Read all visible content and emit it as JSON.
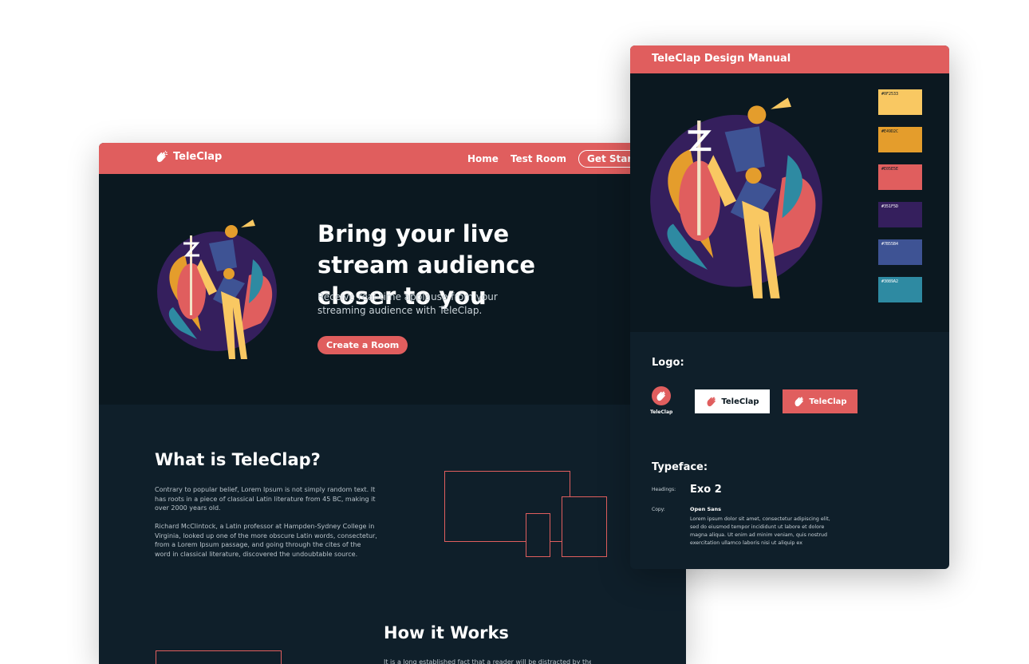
{
  "site": {
    "brand": "TeleClap",
    "nav": {
      "home": "Home",
      "test_room": "Test Room",
      "get_started": "Get Started"
    },
    "hero": {
      "title": "Bring your live stream audience closer to you",
      "subtitle": "Receive real-time applause from your streaming audience with TeleClap.",
      "cta": "Create a Room"
    },
    "about": {
      "title": "What is TeleClap?",
      "p1": "Contrary to popular belief, Lorem Ipsum is not simply random text. It has roots in a piece of classical Latin literature from 45 BC, making it over 2000 years old.",
      "p2": "Richard McClintock, a Latin professor at Hampden-Sydney College in Virginia, looked up one of the more obscure Latin words, consectetur, from a Lorem Ipsum passage, and going through the cites of the word in classical literature, discovered the undoubtable source."
    },
    "how": {
      "title": "How it Works",
      "text": "It is a long established fact that a reader will be distracted by the"
    }
  },
  "manual": {
    "title": "TeleClap Design Manual",
    "swatches": [
      {
        "label": "#0F2533",
        "color": "#f9c862"
      },
      {
        "label": "#E49D2C",
        "color": "#e49d2c"
      },
      {
        "label": "#E05E5E",
        "color": "#e05e5e"
      },
      {
        "label": "#351F5D",
        "color": "#351f5d"
      },
      {
        "label": "#7B55B4",
        "color": "#3e5394"
      },
      {
        "label": "#3089A2",
        "color": "#2e8aa2"
      }
    ],
    "logo_label": "Logo:",
    "logo_mark_text": "TeleClap",
    "logo_light_text": "TeleClap",
    "logo_red_text": "TeleClap",
    "typeface_label": "Typeface:",
    "headings_label": "Headings:",
    "headings_font": "Exo 2",
    "copy_label": "Copy:",
    "copy_font": "Open Sans",
    "copy_sample": "Lorem ipsum dolor sit amet, consectetur adipiscing elit, sed do eiusmod tempor incididunt ut labore et dolore magna aliqua. Ut enim ad minim veniam, quis nostrud exercitation ullamco laboris nisi ut aliquip ex"
  },
  "colors": {
    "accent": "#e05e5e",
    "dark": "#0b1820",
    "panel": "#0f1f2a"
  }
}
